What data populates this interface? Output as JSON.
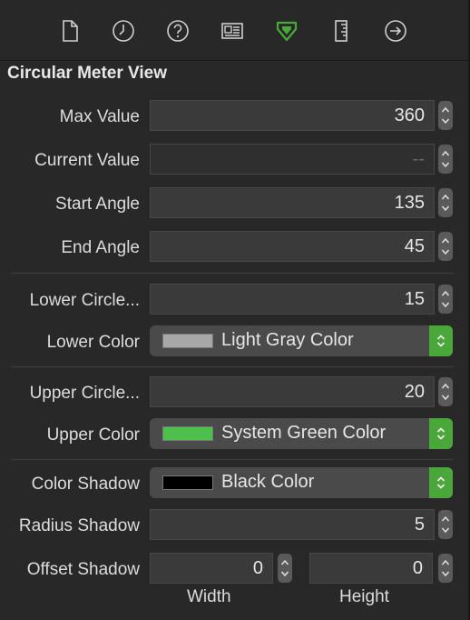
{
  "toolbar": {
    "icons": [
      "file-icon",
      "clock-icon",
      "help-icon",
      "identity-icon",
      "attributes-icon",
      "ruler-icon",
      "connections-icon"
    ],
    "active": "attributes-icon",
    "accent": "#4aa83a"
  },
  "section": {
    "title": "Circular Meter View"
  },
  "fields": {
    "max_value": {
      "label": "Max Value",
      "value": "360"
    },
    "current_value": {
      "label": "Current Value",
      "value": "--"
    },
    "start_angle": {
      "label": "Start Angle",
      "value": "135"
    },
    "end_angle": {
      "label": "End Angle",
      "value": "45"
    },
    "lower_circle": {
      "label": "Lower Circle...",
      "value": "15"
    },
    "lower_color": {
      "label": "Lower Color",
      "value": "Light Gray Color",
      "swatch": "#a8a8a8"
    },
    "upper_circle": {
      "label": "Upper Circle...",
      "value": "20"
    },
    "upper_color": {
      "label": "Upper Color",
      "value": "System Green Color",
      "swatch": "#4cc04a"
    },
    "color_shadow": {
      "label": "Color Shadow",
      "value": "Black Color",
      "swatch": "#000000"
    },
    "radius_shadow": {
      "label": "Radius Shadow",
      "value": "5"
    },
    "offset_shadow": {
      "label": "Offset Shadow",
      "width_value": "0",
      "height_value": "0",
      "width_label": "Width",
      "height_label": "Height"
    }
  }
}
